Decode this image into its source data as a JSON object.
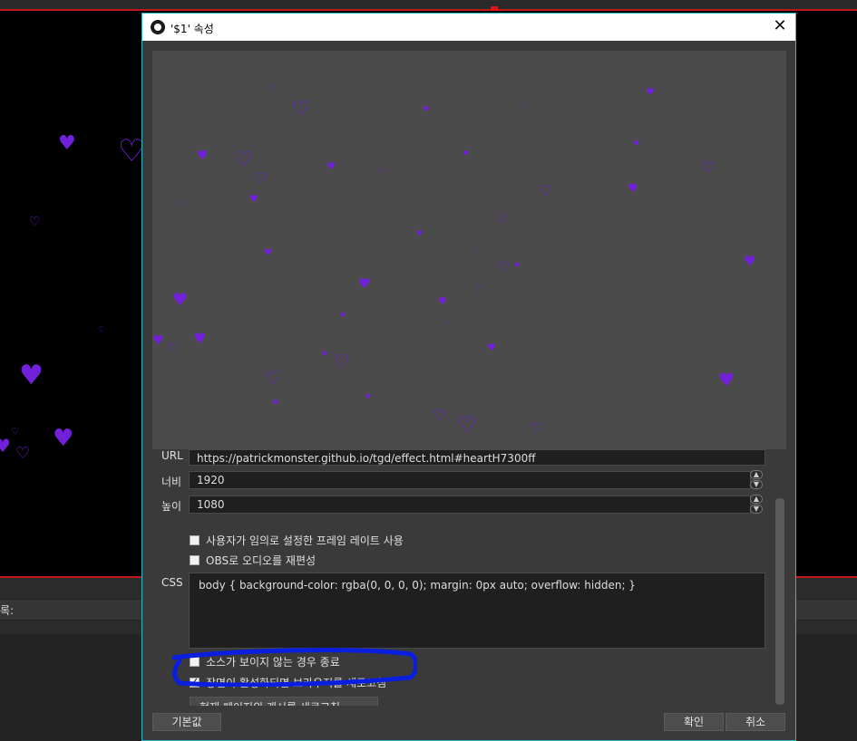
{
  "dialog": {
    "title": "'$1' 속성",
    "close_glyph": "✕"
  },
  "background": {
    "panel_label": "록:",
    "arrows": "◂◂◂◂◂◂"
  },
  "form": {
    "url_label": "URL",
    "url_value": "https://patrickmonster.github.io/tgd/effect.html#heartH7300ff",
    "width_label": "너비",
    "width_value": "1920",
    "height_label": "높이",
    "height_value": "1080",
    "custom_fps_label": "사용자가 임의로 설정한 프레임 레이트 사용",
    "custom_fps_checked": false,
    "reroute_audio_label": "OBS로 오디오를 재편성",
    "reroute_audio_checked": false,
    "css_label": "CSS",
    "css_value": "body { background-color: rgba(0, 0, 0, 0); margin: 0px auto; overflow: hidden; }",
    "shutdown_label": "소스가 보이지 않는 경우 종료",
    "shutdown_checked": false,
    "refresh_on_active_label": "장면이 활성화되면 브라우저를 새로고침",
    "refresh_on_active_checked": true,
    "refresh_cache_label": "현재 페이지의 캐시를 새로고침"
  },
  "buttons": {
    "defaults": "기본값",
    "ok": "확인",
    "cancel": "취소"
  },
  "colors": {
    "heart": "#7220dc",
    "accent_border": "#35b6c9",
    "annotation": "#0a1ee0",
    "red_line": "#c01818"
  },
  "icons": {
    "heart_filled": "♥",
    "heart_outline": "♡",
    "spin_up": "▲",
    "spin_down": "▼"
  }
}
